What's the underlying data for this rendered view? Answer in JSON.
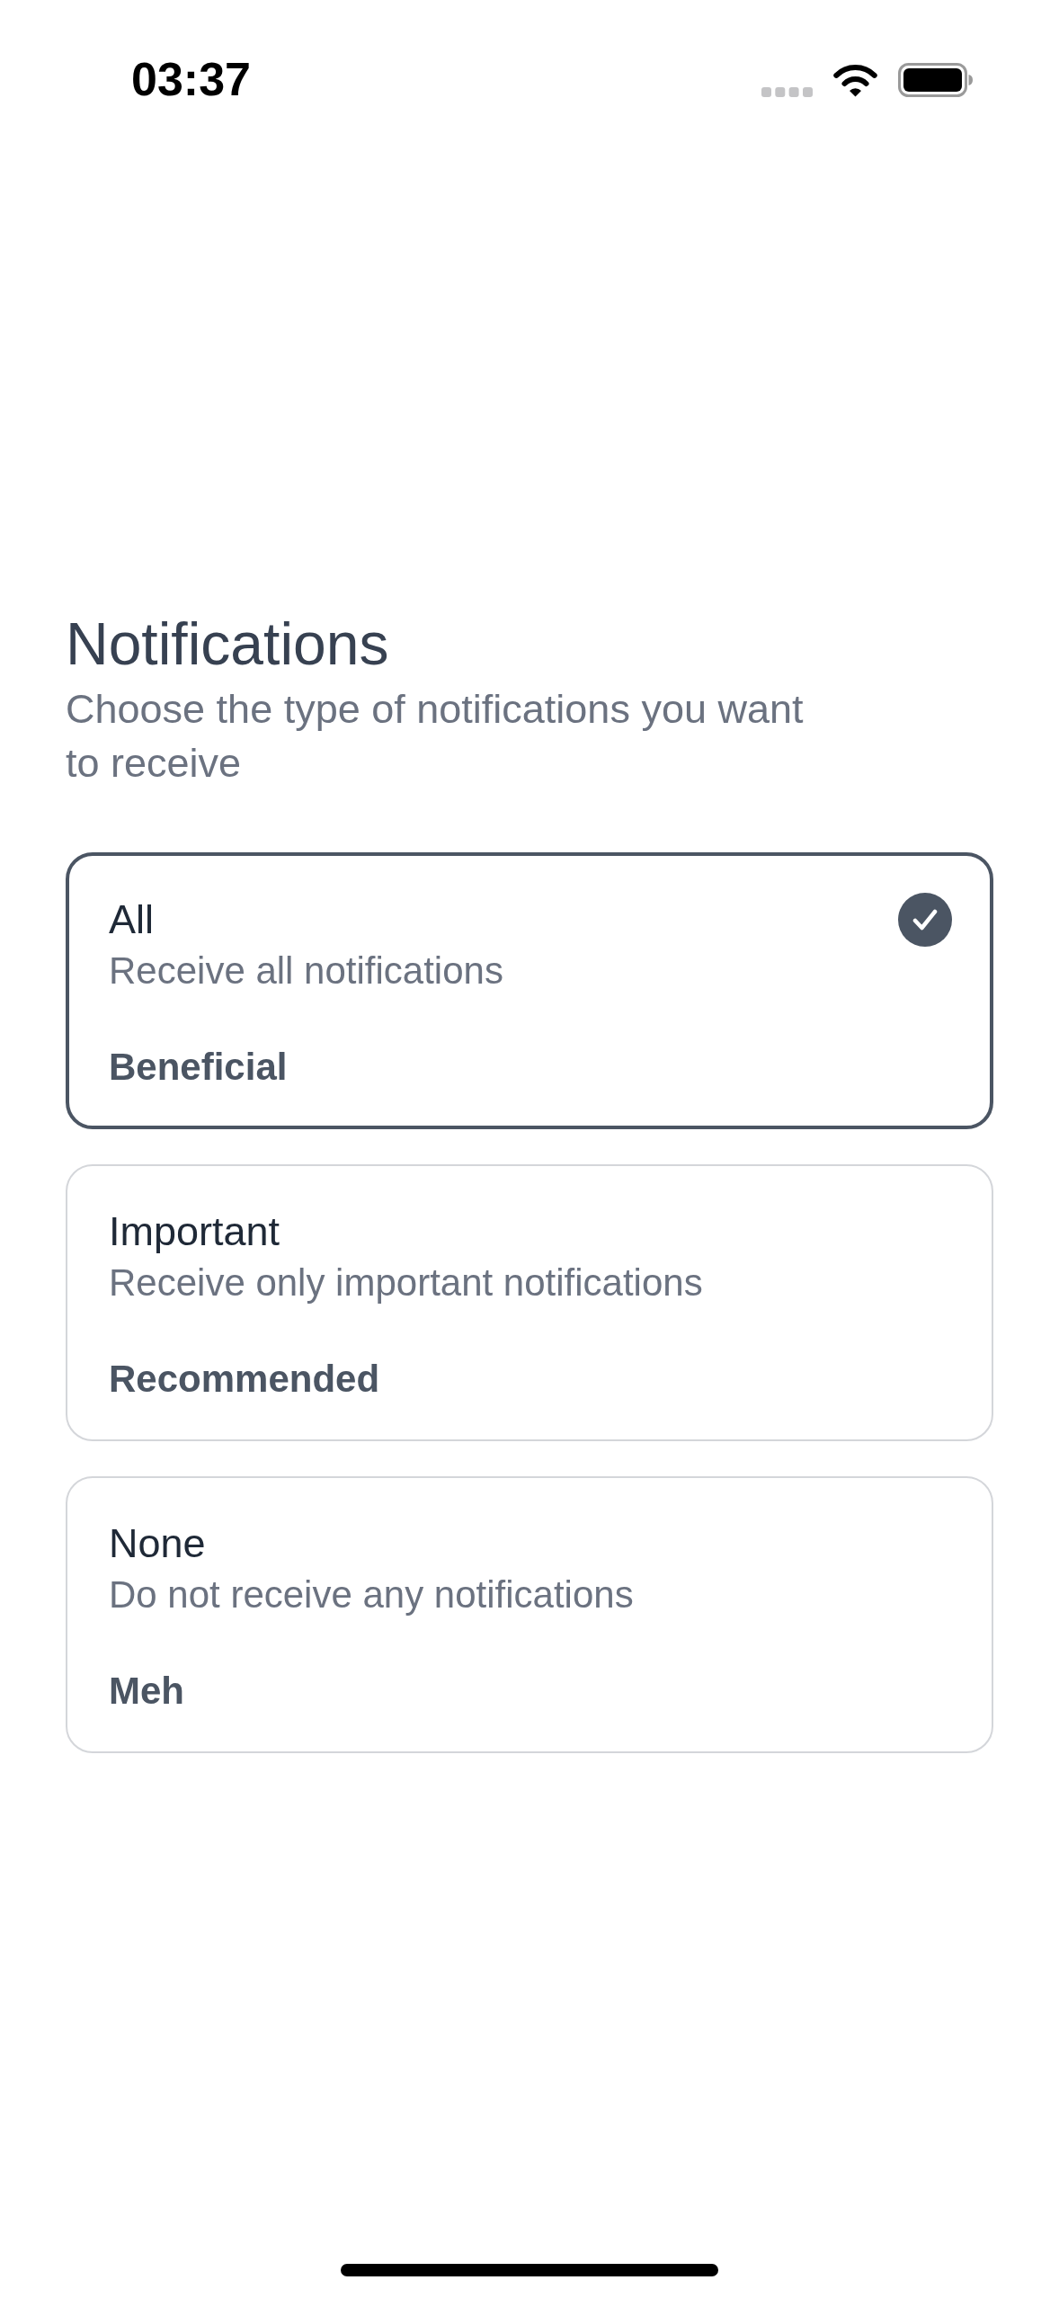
{
  "status_bar": {
    "time": "03:37"
  },
  "header": {
    "title": "Notifications",
    "subtitle": "Choose the type of notifications you want to receive"
  },
  "options": [
    {
      "title": "All",
      "description": "Receive all notifications",
      "tag": "Beneficial",
      "selected": true
    },
    {
      "title": "Important",
      "description": "Receive only important notifications",
      "tag": "Recommended",
      "selected": false
    },
    {
      "title": "None",
      "description": "Do not receive any notifications",
      "tag": "Meh",
      "selected": false
    }
  ]
}
